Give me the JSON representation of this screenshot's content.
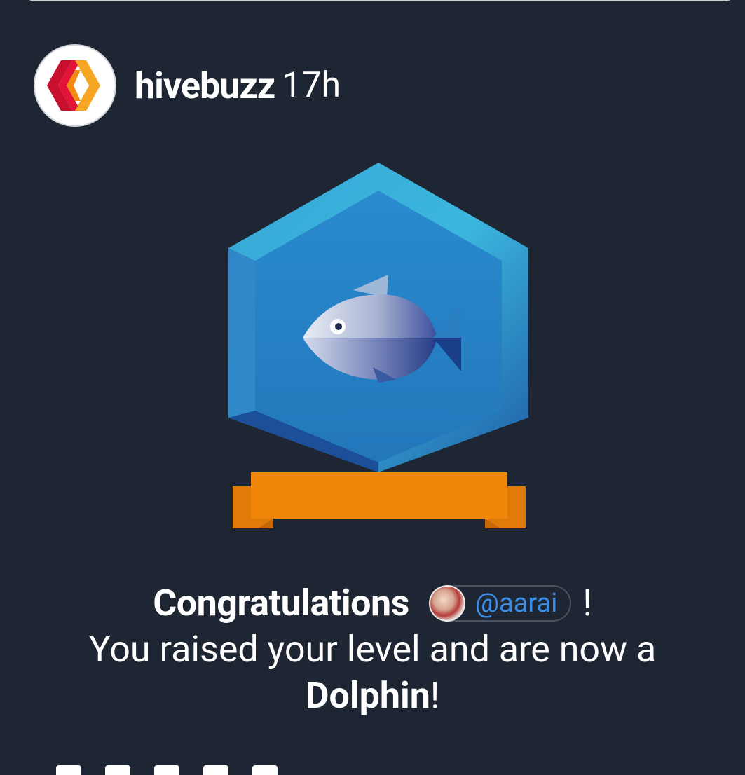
{
  "post": {
    "author": "hivebuzz",
    "time": "17h",
    "avatar_icon": "hive-logo-icon",
    "badge_icon": "fish-badge-icon"
  },
  "message": {
    "congrats": "Congratulations",
    "mention": "@aarai",
    "exclaim": "!",
    "line2": "You raised your level and are now a",
    "level": "Dolphin",
    "level_suffix": "!"
  },
  "colors": {
    "background": "#1f2633",
    "mention_link": "#3b8fe8",
    "ribbon": "#f0870b",
    "hex_outer": "#3fb4d8",
    "hex_inner": "#2a86c4"
  }
}
